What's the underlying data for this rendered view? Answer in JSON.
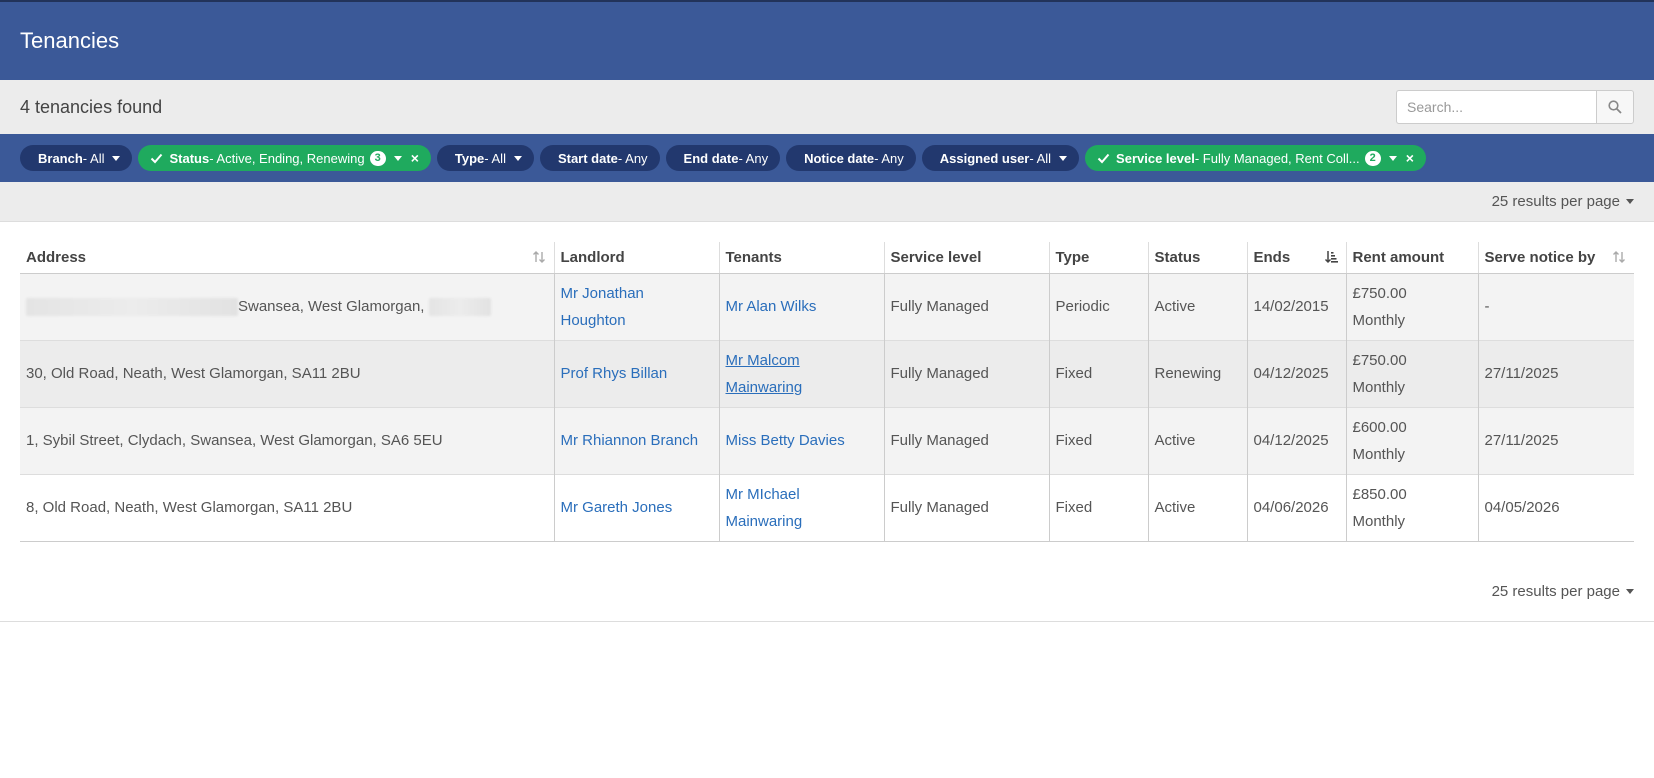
{
  "header": {
    "title": "Tenancies"
  },
  "summary": {
    "count_text": "4 tenancies found",
    "search_placeholder": "Search..."
  },
  "filters": [
    {
      "label": "Branch",
      "value": " - All",
      "active": false
    },
    {
      "label": "Status",
      "value": " - Active, Ending, Renewing",
      "active": true,
      "badge": "3"
    },
    {
      "label": "Type",
      "value": " - All",
      "active": false
    },
    {
      "label": "Start date",
      "value": " - Any",
      "active": false
    },
    {
      "label": "End date",
      "value": " - Any",
      "active": false
    },
    {
      "label": "Notice date",
      "value": " - Any",
      "active": false
    },
    {
      "label": "Assigned user",
      "value": " - All",
      "active": false
    },
    {
      "label": "Service level",
      "value": " - Fully Managed, Rent Coll...",
      "active": true,
      "badge": "2"
    }
  ],
  "pagination": {
    "per_page_label": "25 results per page"
  },
  "table": {
    "columns": [
      "Address",
      "Landlord",
      "Tenants",
      "Service level",
      "Type",
      "Status",
      "Ends",
      "Rent amount",
      "Serve notice by"
    ],
    "rows": [
      {
        "address": "Swansea, West Glamorgan,",
        "landlord": "Mr Jonathan Houghton",
        "tenants": "Mr Alan Wilks",
        "service_level": "Fully Managed",
        "type": "Periodic",
        "status": "Active",
        "ends": "14/02/2015",
        "rent": "£750.00",
        "frequency": "Monthly",
        "notice_by": "-"
      },
      {
        "address": "30, Old Road, Neath, West Glamorgan, SA11 2BU",
        "landlord": "Prof Rhys Billan",
        "tenants": "Mr Malcom Mainwaring",
        "service_level": "Fully Managed",
        "type": "Fixed",
        "status": "Renewing",
        "ends": "04/12/2025",
        "rent": "£750.00",
        "frequency": "Monthly",
        "notice_by": "27/11/2025"
      },
      {
        "address": "1, Sybil Street, Clydach, Swansea, West Glamorgan, SA6 5EU",
        "landlord": "Mr Rhiannon Branch",
        "tenants": "Miss Betty Davies",
        "service_level": "Fully Managed",
        "type": "Fixed",
        "status": "Active",
        "ends": "04/12/2025",
        "rent": "£600.00",
        "frequency": "Monthly",
        "notice_by": "27/11/2025"
      },
      {
        "address": "8, Old Road, Neath, West Glamorgan, SA11 2BU",
        "landlord": "Mr Gareth Jones",
        "tenants": "Mr MIchael Mainwaring",
        "service_level": "Fully Managed",
        "type": "Fixed",
        "status": "Active",
        "ends": "04/06/2026",
        "rent": "£850.00",
        "frequency": "Monthly",
        "notice_by": "04/05/2026"
      }
    ]
  },
  "colors": {
    "header_bg": "#3b5998",
    "chip_bg": "#22386e",
    "chip_active_bg": "#1faa5e",
    "link": "#2a6ebb"
  },
  "icons": {
    "search": "search-icon",
    "check": "check-icon",
    "sort": "sort-icon",
    "sort_asc": "sort-ascending-icon",
    "remove": "close-icon",
    "dropdown": "caret-down-icon"
  }
}
